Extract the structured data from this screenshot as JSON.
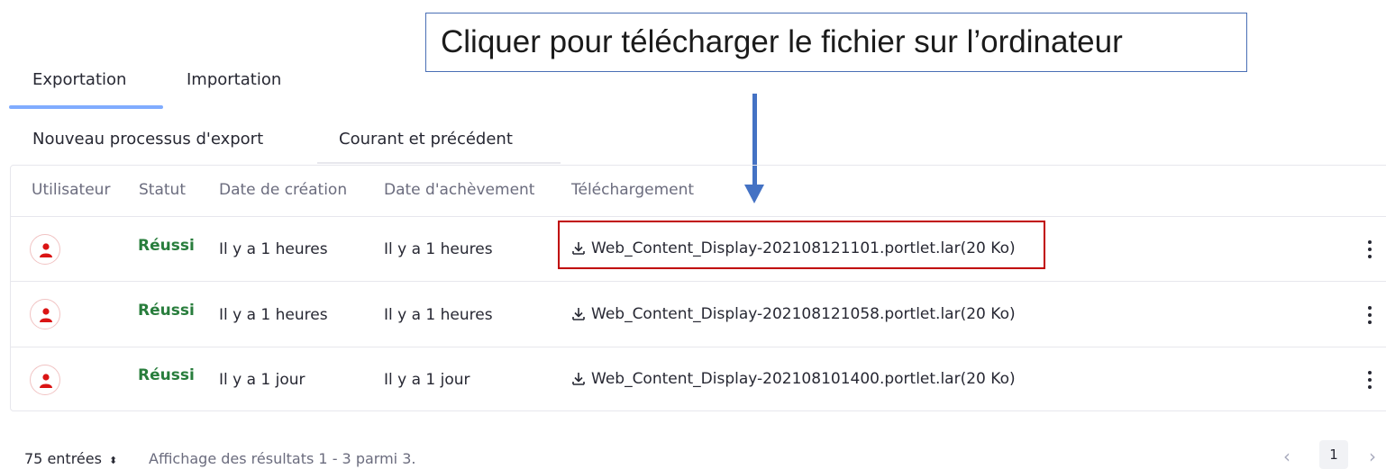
{
  "annotation": {
    "callout_text": "Cliquer pour télécharger le fichier sur l’ordinateur",
    "arrow_color": "#4472c4",
    "highlight_color": "#c00000"
  },
  "tabs": [
    {
      "label": "Exportation",
      "active": true
    },
    {
      "label": "Importation",
      "active": false
    }
  ],
  "subtabs": [
    {
      "label": "Nouveau processus d'export",
      "active": false
    },
    {
      "label": "Courant et précédent",
      "active": true
    }
  ],
  "table": {
    "columns": [
      "Utilisateur",
      "Statut",
      "Date de création",
      "Date d'achèvement",
      "Téléchargement"
    ],
    "rows": [
      {
        "status": "Réussi",
        "created": "Il y a 1 heures",
        "completed": "Il y a 1 heures",
        "download": "Web_Content_Display-202108121101.portlet.lar(20 Ko)"
      },
      {
        "status": "Réussi",
        "created": "Il y a 1 heures",
        "completed": "Il y a 1 heures",
        "download": "Web_Content_Display-202108121058.portlet.lar(20 Ko)"
      },
      {
        "status": "Réussi",
        "created": "Il y a 1 jour",
        "completed": "Il y a 1 jour",
        "download": "Web_Content_Display-202108101400.portlet.lar(20 Ko)"
      }
    ]
  },
  "footer": {
    "entries_label": "75 entrées",
    "results_info": "Affichage des résultats 1 - 3 parmi 3.",
    "current_page": "1"
  },
  "icons": {
    "user": "user-icon",
    "download": "download-icon",
    "kebab": "kebab-menu-icon",
    "sort": "sort-icon",
    "prev": "chevron-left-icon",
    "next": "chevron-right-icon"
  },
  "colors": {
    "status_success": "#287d3c",
    "tab_underline": "#80acff",
    "avatar_icon": "#da1414"
  }
}
